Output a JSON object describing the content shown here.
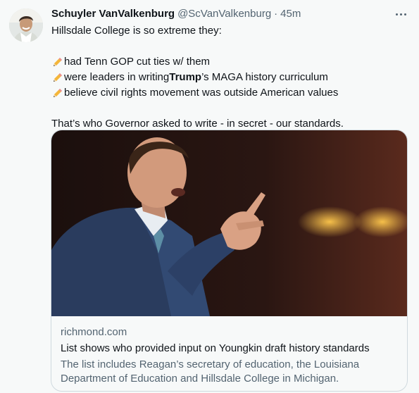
{
  "tweet": {
    "author_name": "Schuyler VanValkenburg",
    "author_handle": "@ScVanValkenburg",
    "separator": "·",
    "time": "45m",
    "lines": {
      "intro": "Hillsdale College is so extreme they:",
      "bullet1": "had Tenn GOP cut ties w/ them",
      "bullet2_pre": "were leaders in writing ",
      "bullet2_bold": "Trump",
      "bullet2_post": "’s MAGA history curriculum",
      "bullet3": "believe civil rights movement was outside American values",
      "closing": "That’s who Governor asked to write - in secret - our standards."
    },
    "bullet_icon": "pencil-icon"
  },
  "card": {
    "domain": "richmond.com",
    "title": "List shows who provided input on Youngkin draft history standards",
    "description": "The list includes Reagan’s secretary of education, the Louisiana Department of Education and Hillsdale College in Michigan."
  },
  "colors": {
    "background": "#f7f9f9",
    "text": "#0f1419",
    "secondary": "#536471",
    "border": "#cfd9de"
  }
}
